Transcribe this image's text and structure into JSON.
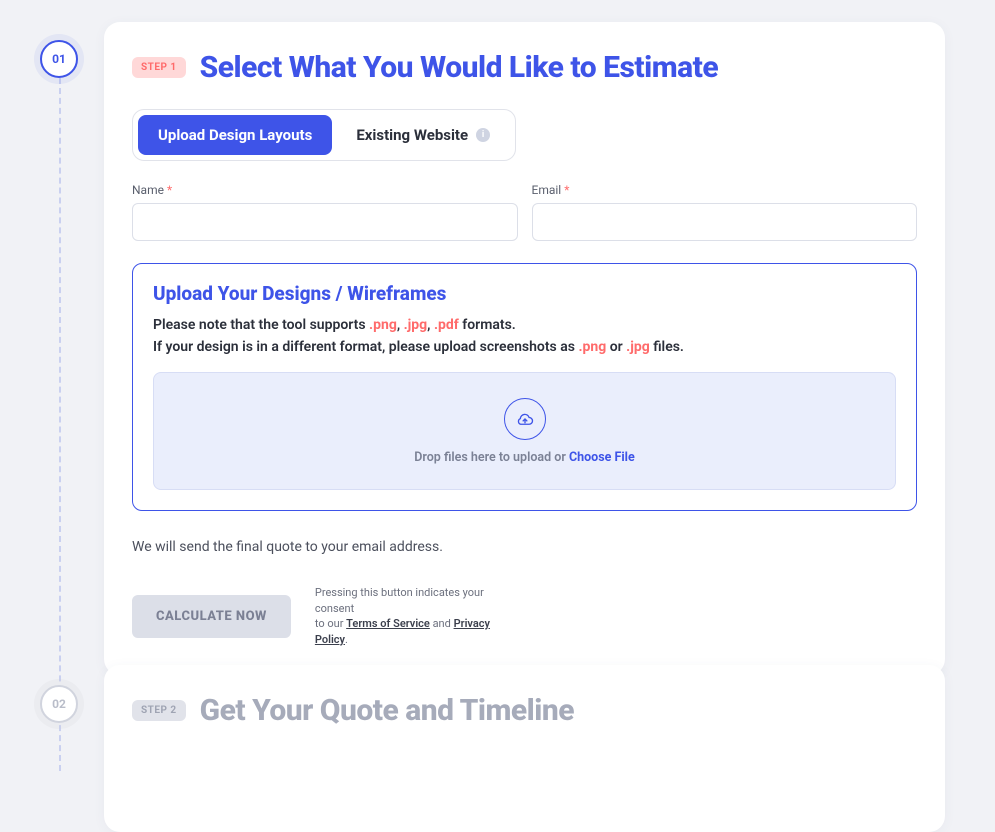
{
  "timeline": {
    "step1_number": "01",
    "step2_number": "02"
  },
  "step1": {
    "badge": "STEP 1",
    "heading": "Select What You Would Like to Estimate",
    "tabs": {
      "upload": "Upload Design Layouts",
      "existing": "Existing Website"
    },
    "fields": {
      "name_label": "Name",
      "email_label": "Email"
    },
    "upload": {
      "title": "Upload Your Designs / Wireframes",
      "note_prefix": "Please note that the tool supports ",
      "ext_png": ".png",
      "ext_jpg": ".jpg",
      "ext_pdf": ".pdf",
      "note_suffix": " formats.",
      "note2_prefix": "If your design is in a different format, please upload screenshots as ",
      "note2_or": " or ",
      "note2_suffix": " files.",
      "drop_text_prefix": "Drop files here to upload or ",
      "drop_link": "Choose File"
    },
    "email_note": "We will send the final quote to your email address.",
    "calc_button": "Calculate Now",
    "consent": {
      "line1": "Pressing this button indicates your consent",
      "line2_prefix": "to our ",
      "terms": "Terms of Service",
      "and": " and ",
      "privacy": "Privacy Policy",
      "period": "."
    }
  },
  "step2": {
    "badge": "STEP 2",
    "heading": "Get Your Quote and Timeline"
  }
}
